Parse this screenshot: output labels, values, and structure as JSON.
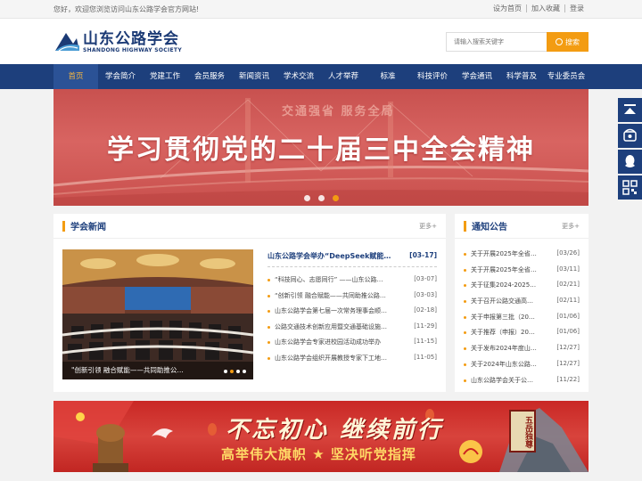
{
  "topbar": {
    "welcome": "您好，欢迎您浏览访问山东公路学会官方网站!",
    "links": [
      "设为首页",
      "加入收藏",
      "登录"
    ]
  },
  "logo": {
    "name_cn": "山东公路学会",
    "name_en": "SHANDONG HIGHWAY SOCIETY"
  },
  "search": {
    "placeholder": "请输入搜索关键字",
    "button_label": "搜索"
  },
  "nav": {
    "items": [
      "首页",
      "学会简介",
      "党建工作",
      "会员服务",
      "新闻资讯",
      "学术交流",
      "人才举荐",
      "标准",
      "科技评价",
      "学会通讯",
      "科学普及",
      "专业委员会"
    ],
    "active": "首页"
  },
  "banner": {
    "headline": "学习贯彻党的二十届三中全会精神",
    "subtext": "交通强省 服务全局",
    "slide_count": 3,
    "active_slide": 3
  },
  "news": {
    "title": "学会新闻",
    "more": "更多+",
    "photo_caption": "\"创新引领 融合赋能——共同助推公…",
    "photo_active_dot": 2,
    "lead": {
      "title": "山东公路学会举办“DeepSeek赋能…",
      "date": "[03-17]"
    },
    "items": [
      {
        "title": "“科技同心、志愿同行” ——山东公路…",
        "date": "[03-07]"
      },
      {
        "title": "“创新引领 融合赋能——共同助推公路…",
        "date": "[03-03]"
      },
      {
        "title": "山东公路学会第七届一次常务理事会顺…",
        "date": "[02-18]"
      },
      {
        "title": "公路交通技术创新应用暨交通基础设施…",
        "date": "[11-29]"
      },
      {
        "title": "山东公路学会专家进校园活动成功举办",
        "date": "[11-15]"
      },
      {
        "title": "山东公路学会组织开展教授专家下工地…",
        "date": "[11-05]"
      }
    ]
  },
  "notice": {
    "title": "通知公告",
    "more": "更多+",
    "items": [
      {
        "title": "关于开展2025年全省…",
        "date": "[03/26]"
      },
      {
        "title": "关于开展2025年全省…",
        "date": "[03/11]"
      },
      {
        "title": "关于征集2024-2025…",
        "date": "[02/21]"
      },
      {
        "title": "关于召开公路交通高…",
        "date": "[02/11]"
      },
      {
        "title": "关于申报第三批（20…",
        "date": "[01/06]"
      },
      {
        "title": "关于推荐（申报）20…",
        "date": "[01/06]"
      },
      {
        "title": "关于发布2024年度山…",
        "date": "[12/27]"
      },
      {
        "title": "关于2024年山东公路…",
        "date": "[12/27]"
      },
      {
        "title": "山东公路学会关于公…",
        "date": "[11/22]"
      }
    ]
  },
  "banner2": {
    "slogan": "不忘初心 继续前行",
    "slogan2": "高举伟大旗帜 ★ 坚决听党指挥",
    "seal": "五岳独尊"
  },
  "side_tools": [
    "top-icon",
    "phone-icon",
    "qq-icon",
    "qrcode-icon"
  ],
  "colors": {
    "brand": "#1d3f7c",
    "accent": "#f39c12",
    "banner_red": "#c8514f"
  }
}
